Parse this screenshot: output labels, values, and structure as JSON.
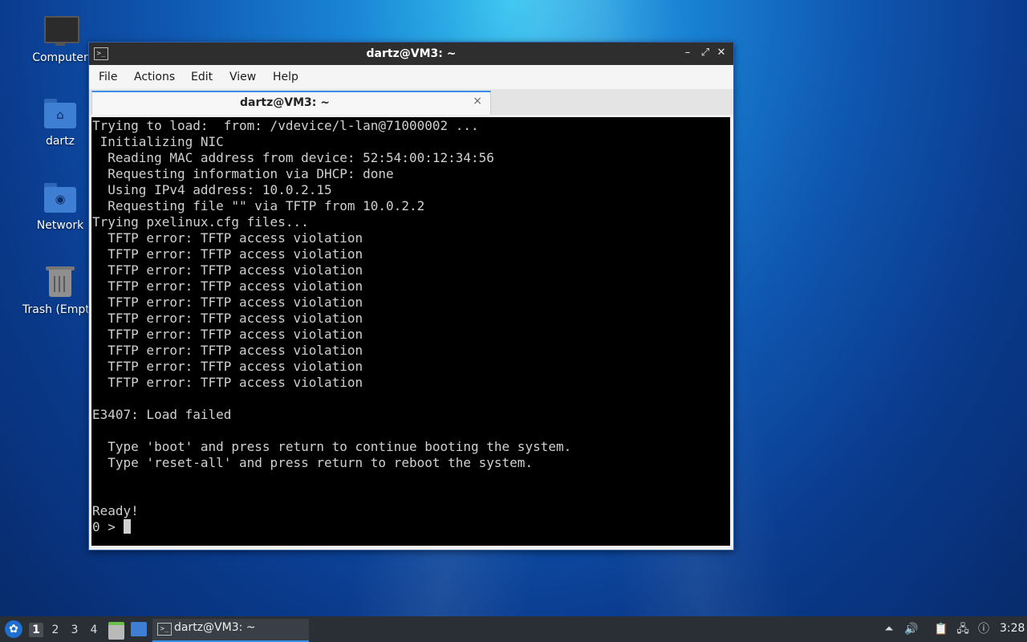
{
  "desktop": {
    "icons": [
      {
        "label": "Computer",
        "icon": "computer-icon"
      },
      {
        "label": "dartz",
        "icon": "home-folder-icon"
      },
      {
        "label": "Network",
        "icon": "network-folder-icon"
      },
      {
        "label": "Trash (Empt",
        "icon": "trash-icon"
      }
    ]
  },
  "window": {
    "title": "dartz@VM3: ~",
    "menu": [
      "File",
      "Actions",
      "Edit",
      "View",
      "Help"
    ],
    "tab_label": "dartz@VM3: ~",
    "tab_close": "×",
    "controls": {
      "minimize": "–",
      "maximize": "⤢",
      "close": "✕"
    }
  },
  "terminal": {
    "lines": [
      "Trying to load:  from: /vdevice/l-lan@71000002 ...",
      " Initializing NIC",
      "  Reading MAC address from device: 52:54:00:12:34:56",
      "  Requesting information via DHCP: done",
      "  Using IPv4 address: 10.0.2.15",
      "  Requesting file \"\" via TFTP from 10.0.2.2",
      "Trying pxelinux.cfg files...",
      "  TFTP error: TFTP access violation",
      "  TFTP error: TFTP access violation",
      "  TFTP error: TFTP access violation",
      "  TFTP error: TFTP access violation",
      "  TFTP error: TFTP access violation",
      "  TFTP error: TFTP access violation",
      "  TFTP error: TFTP access violation",
      "  TFTP error: TFTP access violation",
      "  TFTP error: TFTP access violation",
      "  TFTP error: TFTP access violation",
      "",
      "E3407: Load failed",
      "",
      "  Type 'boot' and press return to continue booting the system.",
      "  Type 'reset-all' and press return to reboot the system.",
      "",
      "",
      "Ready!"
    ],
    "prompt": "0 > "
  },
  "taskbar": {
    "workspaces": [
      "1",
      "2",
      "3",
      "4"
    ],
    "active_workspace": "1",
    "task_label": "dartz@VM3: ~",
    "clock": "3:28",
    "accent": "#3a8ee6"
  }
}
